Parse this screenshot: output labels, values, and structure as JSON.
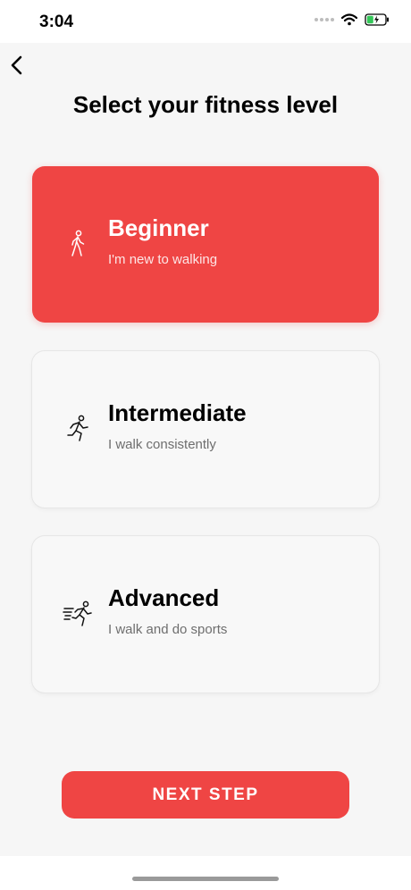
{
  "status_bar": {
    "time": "3:04",
    "icons": [
      "signal-dots",
      "wifi-icon",
      "battery-charging-icon"
    ],
    "battery_color": "#34c759"
  },
  "header": {
    "back_icon": "chevron-left-icon",
    "title": "Select your fitness level"
  },
  "levels": [
    {
      "title": "Beginner",
      "subtitle": "I'm new to walking",
      "icon": "walking-person-icon",
      "selected": true
    },
    {
      "title": "Intermediate",
      "subtitle": "I walk consistently",
      "icon": "running-person-icon",
      "selected": false
    },
    {
      "title": "Advanced",
      "subtitle": "I walk and do sports",
      "icon": "sprinting-person-icon",
      "selected": false
    }
  ],
  "next_button": {
    "label": "NEXT STEP"
  },
  "colors": {
    "accent": "#ef4544",
    "card_background": "#f8f8f8",
    "page_background": "#f6f6f6",
    "subtitle_text": "#6e6e6e"
  }
}
